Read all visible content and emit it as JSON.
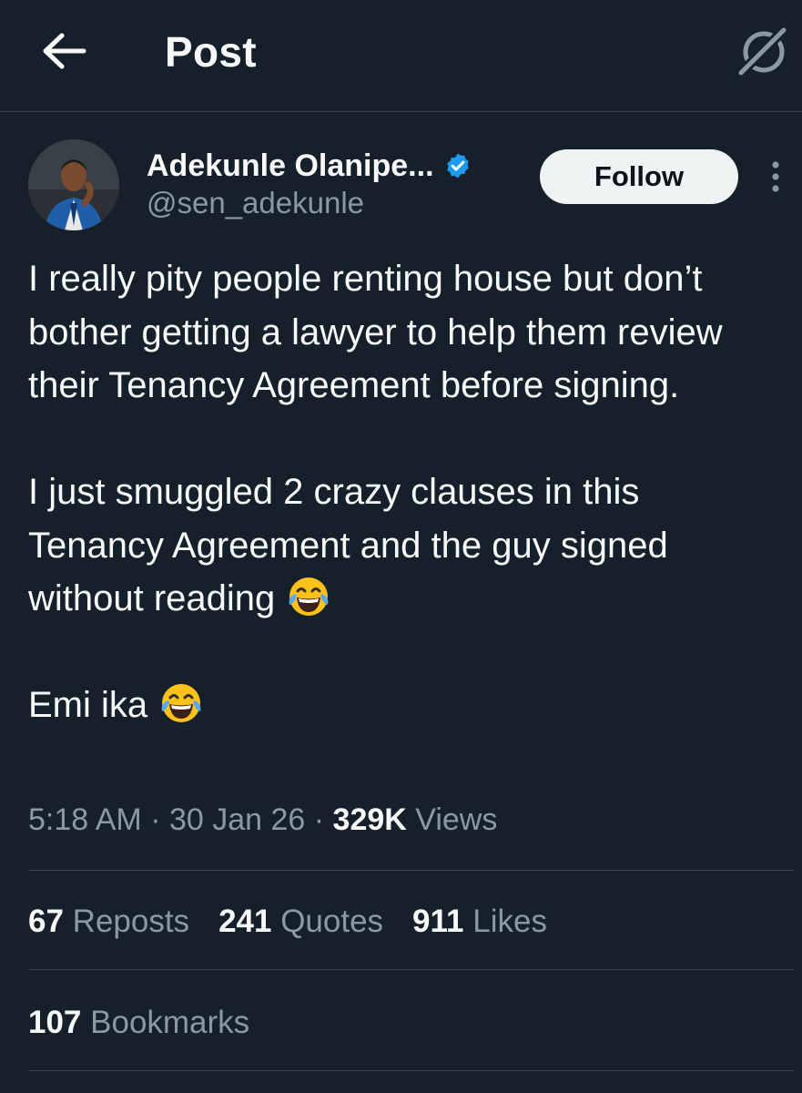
{
  "header": {
    "title": "Post"
  },
  "author": {
    "display_name": "Adekunle Olanipe...",
    "handle": "@sen_adekunle"
  },
  "follow_label": "Follow",
  "post": {
    "paragraphs": [
      "I really pity people renting house but don’t bother getting a lawyer to help them review their Tenancy Agreement before signing.",
      "I just smuggled 2 crazy clauses in this Tenancy Agreement and the guy signed without reading",
      "Emi ika"
    ],
    "emoji": "face-with-tears-of-joy"
  },
  "meta": {
    "time": "5:18 AM",
    "sep1": " · ",
    "date": "30 Jan 26",
    "sep2": " · ",
    "views_count": "329K",
    "views_label": " Views"
  },
  "stats": {
    "reposts_count": "67",
    "reposts_label": " Reposts",
    "quotes_count": "241",
    "quotes_label": " Quotes",
    "likes_count": "911",
    "likes_label": " Likes",
    "bookmarks_count": "107",
    "bookmarks_label": " Bookmarks"
  },
  "colors": {
    "background": "#15202b",
    "text": "#f7f9f9",
    "secondary": "#8b98a5",
    "verified": "#1d9bf0",
    "follow_bg": "#eff3f4",
    "divider": "#38444d"
  }
}
